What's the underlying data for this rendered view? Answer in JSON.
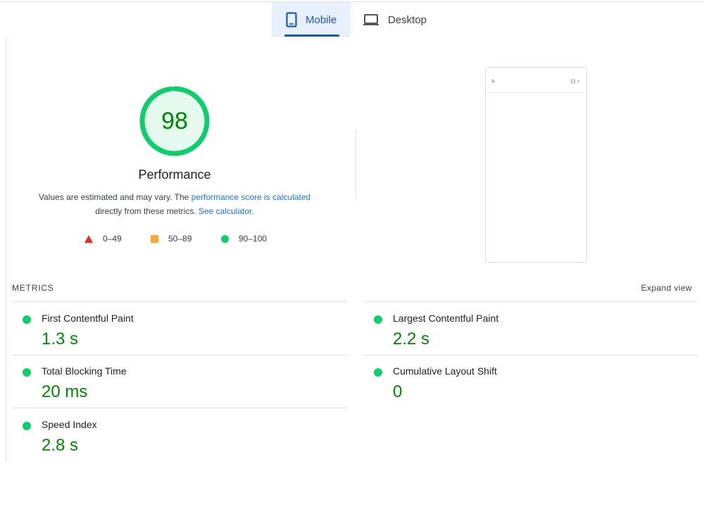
{
  "tabs": [
    {
      "label": "Mobile",
      "icon": "smartphone-icon",
      "active": true
    },
    {
      "label": "Desktop",
      "icon": "laptop-icon",
      "active": false
    }
  ],
  "score": {
    "value": "98",
    "level": 0.98,
    "title": "Performance",
    "color": "#0cce6b"
  },
  "description": {
    "text_before": "Values are estimated and may vary. The ",
    "link_score": "performance score is calculated",
    "text_middle": "directly from these metrics. ",
    "link_calculator": "See calculator."
  },
  "legend": {
    "fail": {
      "label": "0–49",
      "color": "#e62e24",
      "icon": "triangle-icon"
    },
    "average": {
      "label": "50–89",
      "color": "#ffa533",
      "icon": "square-icon"
    },
    "pass": {
      "label": "90–100",
      "color": "#0cce6b",
      "icon": "circle-icon"
    }
  },
  "preview": {
    "menu_glyph": "≡",
    "icons_glyph": "⊡ ⌕"
  },
  "metrics": {
    "label": "METRICS",
    "expand_label": "Expand view",
    "items": [
      {
        "title": "First Contentful Paint",
        "value": "1.3 s"
      },
      {
        "title": "Largest Contentful Paint",
        "value": "2.2 s"
      },
      {
        "title": "Total Blocking Time",
        "value": "20 ms"
      },
      {
        "title": "Cumulative Layout Shift",
        "value": "0"
      },
      {
        "title": "Speed Index",
        "value": "2.8 s"
      }
    ]
  },
  "colors": {
    "accent_blue": "#1a56b8",
    "link_blue": "#1a73e8",
    "pass_green": "#0cce6b",
    "pass_text": "#008800"
  }
}
